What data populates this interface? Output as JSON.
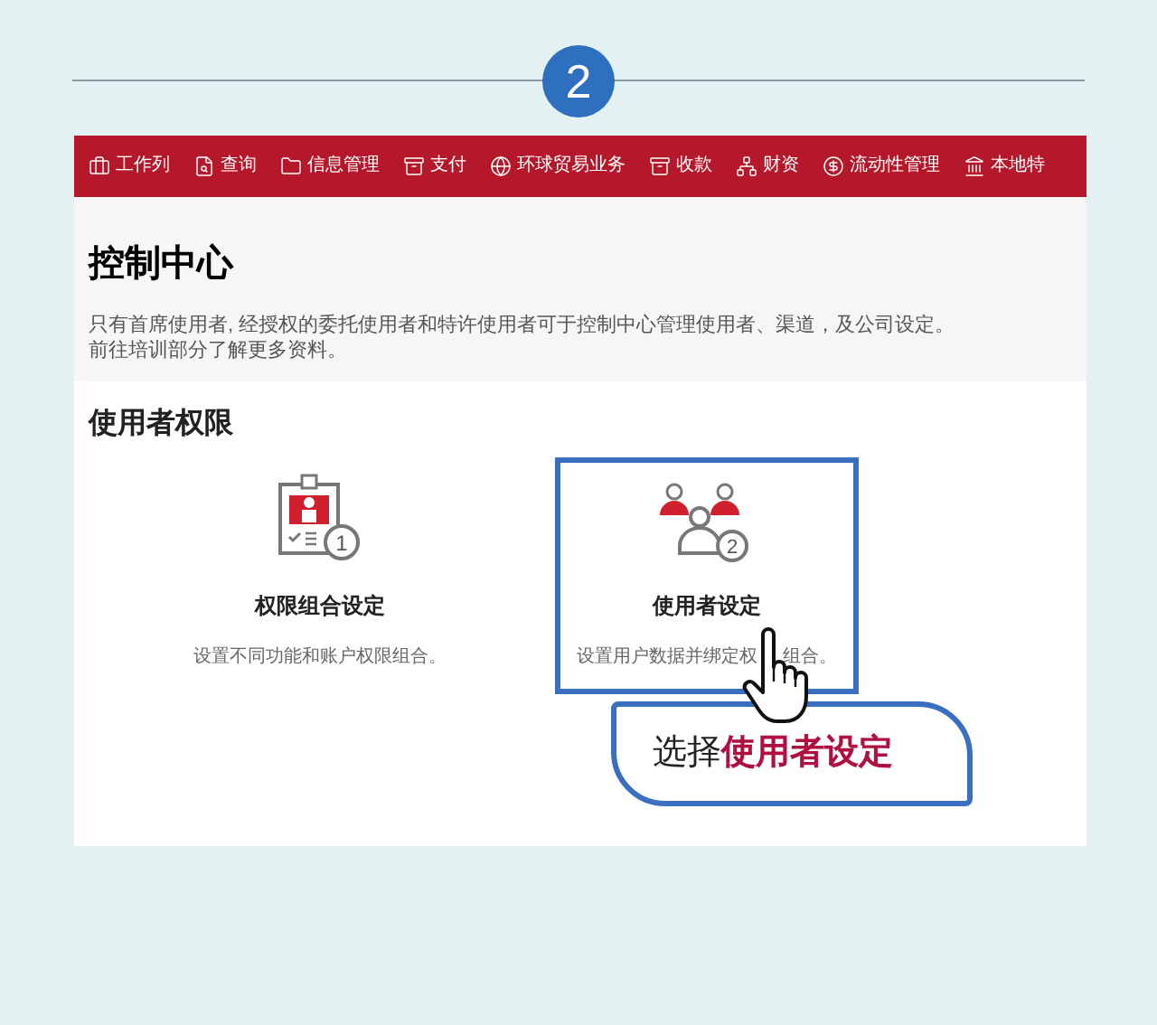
{
  "step": {
    "number": "2"
  },
  "nav": {
    "items": [
      {
        "label": "工作列"
      },
      {
        "label": "查询"
      },
      {
        "label": "信息管理"
      },
      {
        "label": "支付"
      },
      {
        "label": "环球贸易业务"
      },
      {
        "label": "收款"
      },
      {
        "label": "财资"
      },
      {
        "label": "流动性管理"
      },
      {
        "label": "本地特"
      }
    ]
  },
  "header": {
    "title": "控制中心",
    "description": [
      "只有首席使用者, 经授权的委托使用者和特许使用者可于控制中心管理使用者、渠道，及公司设定。",
      "前往培训部分了解更多资料。"
    ]
  },
  "section": {
    "title": "使用者权限",
    "cards": [
      {
        "badge_number": "1",
        "title": "权限组合设定",
        "description": [
          "设置不同功能和账户权限组合。"
        ],
        "highlighted": false
      },
      {
        "badge_number": "2",
        "title": "使用者设定",
        "description": [
          "设置用户数据并绑定权",
          "组合。"
        ],
        "highlighted": true
      }
    ]
  },
  "callout": {
    "text": "选择**使用者设定**"
  }
}
